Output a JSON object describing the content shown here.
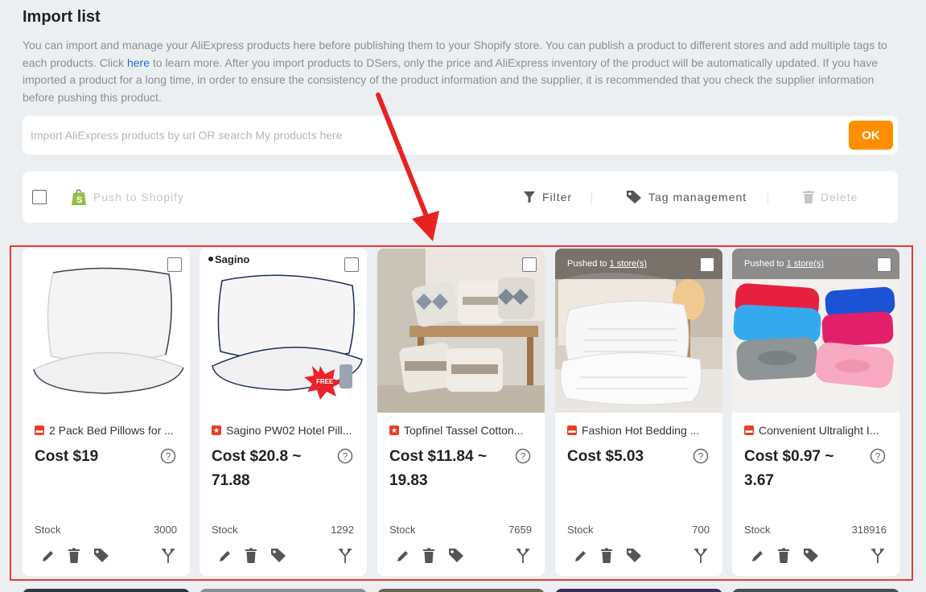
{
  "page": {
    "title": "Import list",
    "intro_before_link": "You can import and manage your AliExpress products here before publishing them to your Shopify store. You can publish a product to different stores and add multiple tags to each products. Click ",
    "intro_link": "here",
    "intro_after_link": " to learn more. After you import products to DSers, only the price and AliExpress inventory of the product will be automatically updated. If you have imported a product for a long time, in order to ensure the consistency of the product information and the supplier, it is recommended that you check the supplier information before pushing this product."
  },
  "search": {
    "placeholder": "Import AliExpress products by url OR search My products here",
    "value": "",
    "ok_label": "OK"
  },
  "toolbar": {
    "push_label": "Push to Shopify",
    "filter_label": "Filter",
    "tag_label": "Tag management",
    "delete_label": "Delete"
  },
  "colors": {
    "accent_orange": "#ff8f00",
    "highlight_red": "#e53935",
    "source_red": "#e83f25",
    "link_blue": "#1a73e8"
  },
  "cards": [
    {
      "title": "2 Pack Bed Pillows for ...",
      "cost": "Cost $19",
      "stock_label": "Stock",
      "stock": "3000",
      "pushed": false,
      "source_icon": "aliexpress-icon"
    },
    {
      "title": "Sagino PW02 Hotel Pill...",
      "cost": "Cost $20.8 ~ 71.88",
      "stock_label": "Stock",
      "stock": "1292",
      "pushed": false,
      "source_icon": "store-icon",
      "image_brand": "Sagino",
      "image_badge": "FREE"
    },
    {
      "title": "Topfinel Tassel Cotton...",
      "cost": "Cost $11.84 ~ 19.83",
      "stock_label": "Stock",
      "stock": "7659",
      "pushed": false,
      "source_icon": "store-icon"
    },
    {
      "title": "Fashion Hot Bedding ...",
      "cost": "Cost $5.03",
      "stock_label": "Stock",
      "stock": "700",
      "pushed": true,
      "pushed_prefix": "Pushed to ",
      "pushed_link": "1 store(s)",
      "source_icon": "aliexpress-icon"
    },
    {
      "title": "Convenient Ultralight I...",
      "cost": "Cost $0.97 ~ 3.67",
      "stock_label": "Stock",
      "stock": "318916",
      "pushed": true,
      "pushed_prefix": "Pushed to ",
      "pushed_link": "1 store(s)",
      "source_icon": "aliexpress-icon"
    }
  ]
}
